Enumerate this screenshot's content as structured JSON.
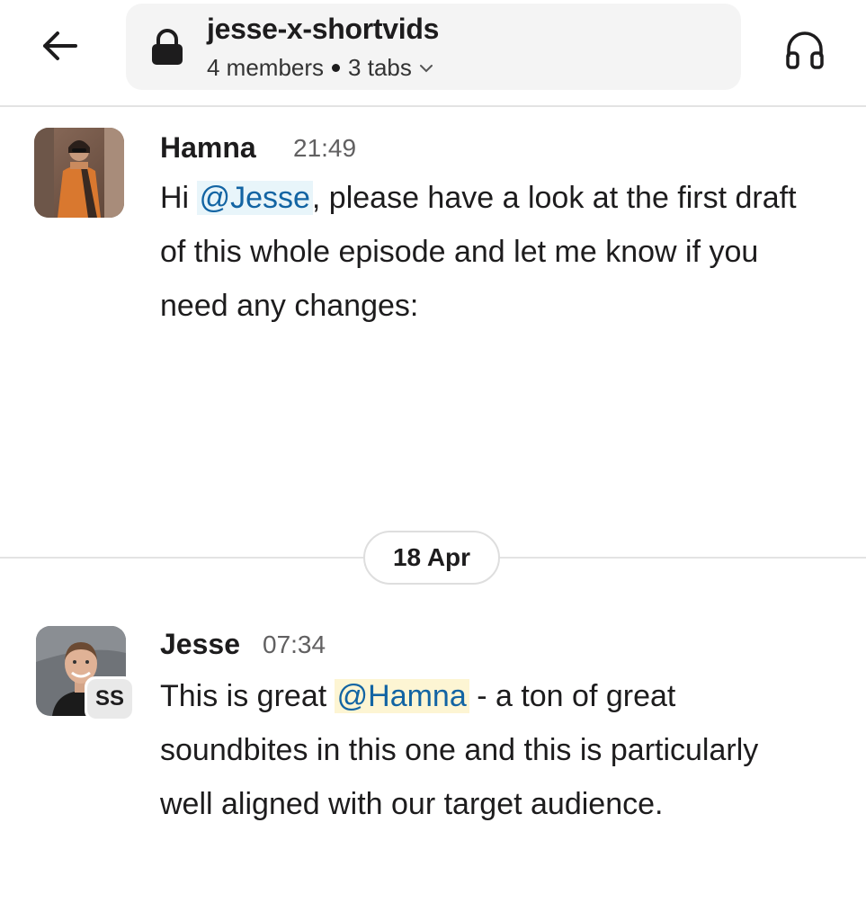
{
  "header": {
    "back_icon": "arrow-left-icon",
    "lock_icon": "lock-icon",
    "channel_name": "jesse-x-shortvids",
    "members": "4 members",
    "tabs": "3 tabs",
    "expand_icon": "chevron-down-icon",
    "huddle_icon": "headphones-icon"
  },
  "messages": [
    {
      "sender": "Hamna",
      "time": "21:49",
      "text_before": "Hi ",
      "mention": "@Jesse",
      "text_after": ", please have a look at the first draft of this whole episode and let me know if you need any changes:"
    },
    {
      "sender": "Jesse",
      "time": "07:34",
      "status": "SS",
      "text_before": "This is great ",
      "mention": "@Hamna",
      "text_after": " - a ton of great soundbites in this one and this is particularly well aligned with our target audience."
    }
  ],
  "date_divider": "18 Apr",
  "colors": {
    "mention_text": "#1264a3",
    "mention_bg_blue": "#e8f5fa",
    "mention_bg_yellow": "#fdf5d3",
    "divider": "#e3e3e3"
  }
}
